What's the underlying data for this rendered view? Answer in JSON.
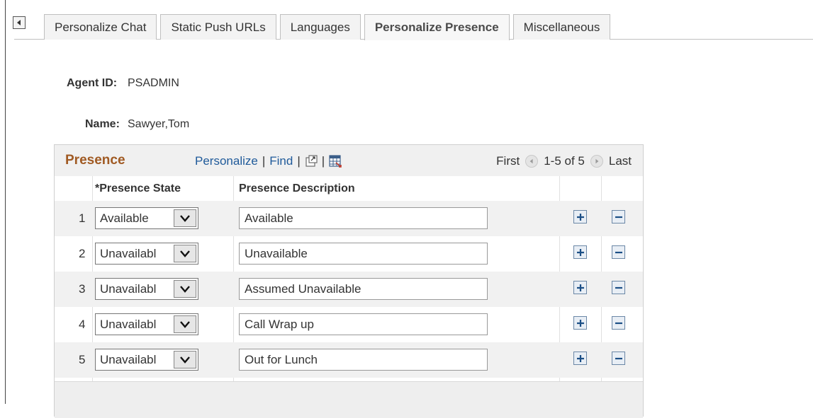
{
  "tabs": [
    {
      "label": "Personalize Chat",
      "active": false
    },
    {
      "label": "Static Push URLs",
      "active": false
    },
    {
      "label": "Languages",
      "active": false
    },
    {
      "label": "Personalize Presence",
      "active": true
    },
    {
      "label": "Miscellaneous",
      "active": false
    }
  ],
  "agent": {
    "id_label": "Agent ID:",
    "id_value": "PSADMIN",
    "name_label": "Name:",
    "name_value": "Sawyer,Tom"
  },
  "grid": {
    "title": "Presence",
    "personalize": "Personalize",
    "find": "Find",
    "first": "First",
    "range": "1-5 of 5",
    "last": "Last",
    "col_state": "*Presence State",
    "col_desc": "Presence Description",
    "rows": [
      {
        "num": "1",
        "state": "Available",
        "desc": "Available"
      },
      {
        "num": "2",
        "state": "Unavailabl",
        "desc": "Unavailable"
      },
      {
        "num": "3",
        "state": "Unavailabl",
        "desc": "Assumed Unavailable"
      },
      {
        "num": "4",
        "state": "Unavailabl",
        "desc": "Call Wrap up"
      },
      {
        "num": "5",
        "state": "Unavailabl",
        "desc": "Out for Lunch"
      }
    ]
  },
  "colors": {
    "accent": "#a05a23",
    "link": "#1f5a9a"
  }
}
